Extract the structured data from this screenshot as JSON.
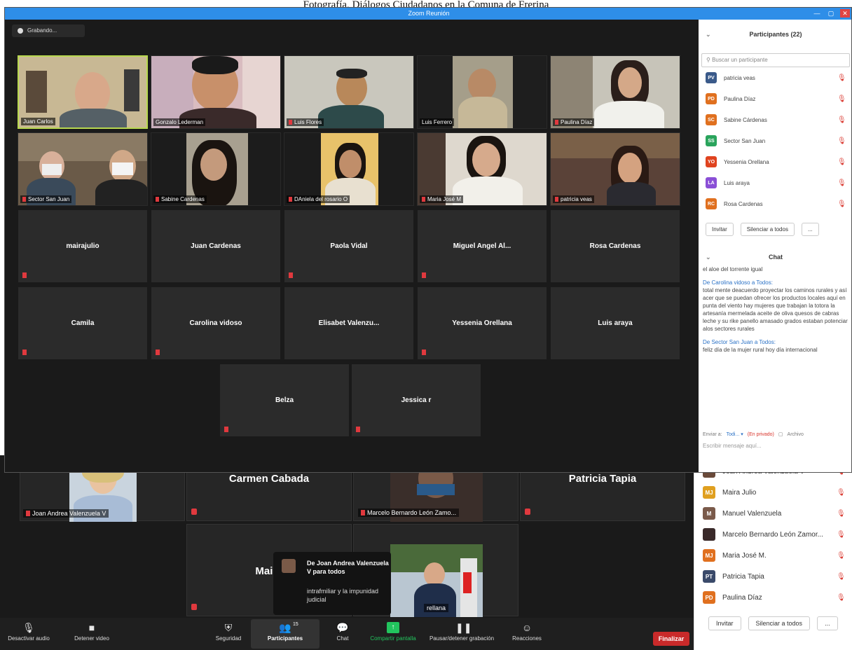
{
  "caption": "Fotografía, Diálogos Ciudadanos en la Comuna de Frerina",
  "window": {
    "title": "Zoom Reunión"
  },
  "recording": {
    "label": "Grabando..."
  },
  "video_tiles": [
    {
      "name": "Juan Carlos",
      "muted": false,
      "active": true
    },
    {
      "name": "Gonzalo Lederman",
      "muted": false
    },
    {
      "name": "Luis Flores",
      "muted": true
    },
    {
      "name": "Luis Ferrero",
      "muted": false
    },
    {
      "name": "Paulina Díaz",
      "muted": true
    },
    {
      "name": "Sector San Juan",
      "muted": true
    },
    {
      "name": "Sabine Cardenas",
      "muted": true
    },
    {
      "name": "DAniela del rosario O",
      "muted": true
    },
    {
      "name": "Maria José M",
      "muted": true
    },
    {
      "name": "patricia veas",
      "muted": true
    }
  ],
  "name_tiles": [
    {
      "name": "mairajulio",
      "muted": true
    },
    {
      "name": "Juan Cardenas",
      "muted": false
    },
    {
      "name": "Paola Vidal",
      "muted": true
    },
    {
      "name": "Miguel Angel Al...",
      "muted": true
    },
    {
      "name": "Rosa Cardenas",
      "muted": false
    },
    {
      "name": "Camila",
      "muted": true
    },
    {
      "name": "Carolina vidoso",
      "muted": true
    },
    {
      "name": "Elisabet Valenzu...",
      "muted": false
    },
    {
      "name": "Yessenia Orellana",
      "muted": true
    },
    {
      "name": "Luis araya",
      "muted": false
    },
    {
      "name": "Belza",
      "muted": true
    },
    {
      "name": "Jessica r",
      "muted": true
    }
  ],
  "front_sidebar": {
    "participants_title": "Participantes (22)",
    "search_placeholder": "Buscar un participante",
    "participants": [
      {
        "initials": "PV",
        "name": "patricia veas",
        "color": "#3a5a8a"
      },
      {
        "initials": "PD",
        "name": "Paulina Díaz",
        "color": "#e0701f"
      },
      {
        "initials": "SC",
        "name": "Sabine Cárdenas",
        "color": "#e0701f"
      },
      {
        "initials": "SS",
        "name": "Sector San Juan",
        "color": "#2aa45c"
      },
      {
        "initials": "YO",
        "name": "Yessenia Orellana",
        "color": "#e0431f"
      },
      {
        "initials": "LA",
        "name": "Luis araya",
        "color": "#8a4fd6"
      },
      {
        "initials": "RC",
        "name": "Rosa Cardenas",
        "color": "#e0701f"
      }
    ],
    "invite": "Invitar",
    "mute_all": "Silenciar a todos",
    "more": "...",
    "chat_title": "Chat",
    "chat_first": "el aloe del torrente igual",
    "chat_msgs": [
      {
        "from": "De Carolina vidoso a Todos:",
        "text": "total mente deacuerdo proyectar los caminos rurales y así acer que se puedan ofrecer los productos locales aquí en punta del viento hay mujeres que trabajan la totora la artesanía mermelada aceite de oliva quesos de cabras leche y su rike panello amasado grados estaban potenciar alos sectores rurales"
      },
      {
        "from": "De Sector San Juan a Todos:",
        "text": "feliz día de la mujer rural hoy día internacional"
      }
    ],
    "send_to_label": "Enviar a:",
    "send_to_value": "Todi... ▾",
    "send_privacy": "(En privado)",
    "file_label": "Archivo",
    "compose_placeholder": "Escribir mensaje aquí..."
  },
  "back_tiles": [
    {
      "name": "Joan Andrea Valenzuela V"
    },
    {
      "name": "Carmen Cabada"
    },
    {
      "name": "Marcelo Bernardo León Zamo..."
    },
    {
      "name": "Patricia Tapia"
    },
    {
      "name": "Maira"
    },
    {
      "name": "rellana"
    }
  ],
  "back_sidebar": {
    "participants": [
      {
        "initials": "",
        "name": "Joan Andrea Valenzuela V",
        "color": "#6a4a3a"
      },
      {
        "initials": "MJ",
        "name": "Maira Julio",
        "color": "#e0a020"
      },
      {
        "initials": "M",
        "name": "Manuel Valenzuela",
        "color": "#7a5a4a"
      },
      {
        "initials": "",
        "name": "Marcelo Bernardo León Zamor...",
        "color": "#3a2a2a"
      },
      {
        "initials": "MJ",
        "name": "Maria José M.",
        "color": "#e0701f"
      },
      {
        "initials": "PT",
        "name": "Patricia Tapia",
        "color": "#3a4a6a"
      },
      {
        "initials": "PD",
        "name": "Paulina Díaz",
        "color": "#e0701f"
      }
    ],
    "invite": "Invitar",
    "mute_all": "Silenciar a todos",
    "more": "..."
  },
  "popup": {
    "title": "De Joan Andrea Valenzuela V para todos",
    "body": "intrafmiliar y la impunidad judicial"
  },
  "toolbar": {
    "mute": "Desactivar audio",
    "stop_video": "Detener video",
    "security": "Seguridad",
    "participants": "Participantes",
    "participants_count": "15",
    "chat": "Chat",
    "share": "Compartir pantalla",
    "pause_rec": "Pausar/detener grabación",
    "reactions": "Reacciones",
    "end": "Finalizar"
  },
  "colors": {
    "accent": "#2e8ee8",
    "active_speaker": "#b8d84f",
    "mic_off": "#e0393e",
    "share": "#22c55e",
    "end": "#c92a2a"
  }
}
